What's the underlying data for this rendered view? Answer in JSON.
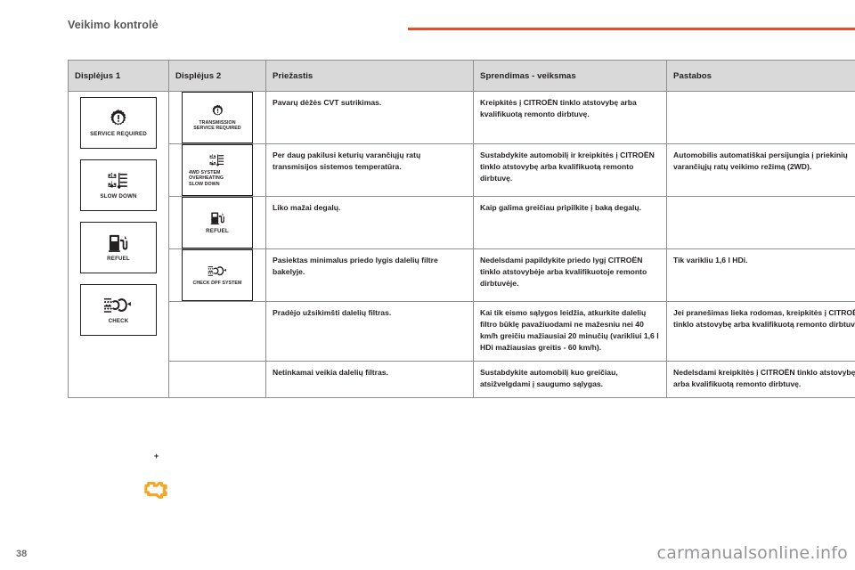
{
  "header": {
    "title": "Veikimo kontrolė"
  },
  "table": {
    "columns": [
      {
        "label": "Displėjus 1"
      },
      {
        "label": "Displėjus 2"
      },
      {
        "label": "Priežastis"
      },
      {
        "label": "Sprendimas - veiksmas"
      },
      {
        "label": "Pastabos"
      }
    ],
    "rows": [
      {
        "display1": {
          "icon": "gear-exclamation-icon",
          "label": "SERVICE REQUIRED"
        },
        "display2": {
          "icon": "gear-exclamation-icon",
          "label": "TRANSMISSION\nSERVICE REQUIRED"
        },
        "cause": "Pavarų dėžės CVT sutrikimas.",
        "solution": "Kreipkitės į CITROËN tinklo atstovybę arba kvalifikuotą remonto dirbtuvę.",
        "notes": ""
      },
      {
        "display1": {
          "icon": "4wd-drivetrain-icon",
          "label": "SLOW DOWN"
        },
        "display2": {
          "icon": "4wd-drivetrain-icon",
          "label": "4WD SYSTEM OVERHEATING\nSLOW DOWN"
        },
        "cause": "Per daug pakilusi keturių varančiųjų ratų transmisijos sistemos temperatūra.",
        "solution": "Sustabdykite automobilį ir kreipkitės į CITROËN tinklo atstovybę arba kvalifikuotą remonto dirbtuvę.",
        "notes": "Automobilis automatiškai persijungia į priekinių varančiųjų ratų veikimo režimą (2WD)."
      },
      {
        "display1": {
          "icon": "fuel-pump-icon",
          "label": "REFUEL"
        },
        "display2": {
          "icon": "fuel-pump-icon",
          "label": "REFUEL"
        },
        "cause": "Liko mažai degalų.",
        "solution": "Kaip galima greičiau pripilkite į baką degalų.",
        "notes": ""
      },
      {
        "display1": {
          "icon": "dpf-particle-filter-icon",
          "label": "CHECK"
        },
        "display2": {
          "icon": "dpf-particle-filter-icon",
          "label": "CHECK DPF SYSTEM"
        },
        "cause": "Pasiektas minimalus priedo lygis dalelių filtre bakelyje.",
        "solution": "Nedelsdami papildykite priedo lygį CITROËN tinklo atstovybėje arba kvalifikuotoje remonto dirbtuvėje.",
        "notes": "Tik varikliu 1,6 l HDi."
      },
      {
        "cause": "Pradėjo užsikimšti dalelių filtras.",
        "solution": "Kai tik eismo sąlygos leidžia, atkurkite dalelių filtro būklę pavažiuodami ne mažesniu nei 40 km/h greičiu mažiausiai 20 minučių (varikliui 1,6 l HDi mažiausias greitis - 60 km/h).",
        "notes": "Jei pranešimas lieka rodomas, kreipkitės į CITROËN tinklo atstovybę arba kvalifikuotą remonto dirbtuvę."
      },
      {
        "cause": "Netinkamai veikia dalelių filtras.",
        "solution": "Sustabdykite automobilį kuo greičiau, atsižvelgdami į saugumo sąlygas.",
        "notes": "Nedelsdami kreipkitės į CITROËN tinklo atstovybę arba kvalifikuotą remonto dirbtuvę."
      }
    ],
    "marks": {
      "plus": "+",
      "engine_icon": "engine-warning-icon"
    }
  },
  "footer": {
    "page_number": "38",
    "watermark": "carmanualsonline.info"
  },
  "colors": {
    "accent": "#ef4823",
    "header_text": "#58595b",
    "table_header_bg": "#d9d9d9",
    "border": "#8d8f92",
    "body_text": "#231f20",
    "engine_icon": "#f5a623"
  }
}
